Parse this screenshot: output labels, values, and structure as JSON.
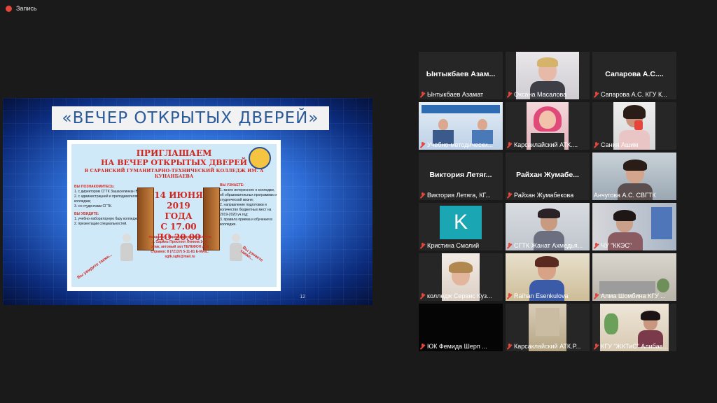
{
  "recording": {
    "label": "Запись"
  },
  "share": {
    "slide_title": "«ВЕЧЕР ОТКРЫТЫХ ДВЕРЕЙ»",
    "poster": {
      "h1": "ПРИГЛАШАЕМ",
      "h2": "НА ВЕЧЕР ОТКРЫТЫХ ДВЕРЕЙ",
      "h3": "В САРАНСКИЙ ГУМАНИТАРНО-ТЕХНИЧЕСКИЙ КОЛЛЕДЖ ИМ. А КУНАНБАЕВА",
      "left_head": "ВЫ ПОЗНАКОМИТЕСЬ:",
      "left_items": [
        "1. с директором СГТК Зашаселинкан В.А.;",
        "2. с администрацией и преподавателями колледжа;",
        "3. со студентами СГТК."
      ],
      "left_head2": "ВЫ УВИДИТЕ:",
      "left_items2": [
        "1. учебно-лабораторную базу колледжа;",
        "2. презентации специальностей."
      ],
      "right_head": "ВЫ УЗНАЕТЕ:",
      "right_items": [
        "1. много интересного о колледже, об образовательных программах и студенческой жизни;",
        "2. направление подготовки и количество бюджетных мест на 2019-2020 уч.год;",
        "3. правила приема и обучения в колледже."
      ],
      "date_l1": "14 ИЮНЯ",
      "date_l2": "2019 ГОДА",
      "date_l3": "С 17.00",
      "date_l4": "ДО 20.00",
      "address": "по адресу: Карагандинская область г. Сарань Проспект Ленина 14 1 этаж, актовый зал ТЕЛЕФОН для справок: 8 (72137) 5-11-81 E-MAIL: sgtk.sgtk@mail.ru",
      "side_left": "Вы увидите также...",
      "side_right": "Вы узнаете также..."
    },
    "slide_number": "12"
  },
  "participants": [
    {
      "display_name": "Ынтыкбаев Азам...",
      "label": "Ынтыкбаев Азамат",
      "video": false,
      "muted": true
    },
    {
      "display_name": "",
      "label": "Оксана Масалова",
      "video": true,
      "muted": true
    },
    {
      "display_name": "Сапарова А.С....",
      "label": "Сапарова А.С. КГУ К...",
      "video": false,
      "muted": true
    },
    {
      "display_name": "",
      "label": "Учебно-методически...",
      "video": true,
      "muted": true
    },
    {
      "display_name": "",
      "label": "Карсаклайский АТК....",
      "video": true,
      "muted": true
    },
    {
      "display_name": "",
      "label": "Сания Ашим",
      "video": true,
      "muted": true
    },
    {
      "display_name": "Виктория Летяг...",
      "label": "Виктория Летяга, КГ...",
      "video": false,
      "muted": true
    },
    {
      "display_name": "Райхан Жумабе...",
      "label": "Райхан Жумабекова",
      "video": false,
      "muted": true
    },
    {
      "display_name": "",
      "label": "Анчугова А.С. СВГТК",
      "video": true,
      "muted": false,
      "active": true
    },
    {
      "display_name": "",
      "label": "Кристина Смолий",
      "video": false,
      "muted": true,
      "avatar_letter": "K"
    },
    {
      "display_name": "",
      "label": "СГТК Жанат Ахмедья...",
      "video": true,
      "muted": true
    },
    {
      "display_name": "",
      "label": "ЧУ \"ККЭС\"",
      "video": true,
      "muted": true
    },
    {
      "display_name": "",
      "label": "колледж Сервис Куз...",
      "video": true,
      "muted": true
    },
    {
      "display_name": "",
      "label": "Raihan Esenkulova",
      "video": true,
      "muted": true
    },
    {
      "display_name": "",
      "label": "Алма Шомбина КГУ ...",
      "video": true,
      "muted": true
    },
    {
      "display_name": "",
      "label": "ЮК Фемида Шерп ...",
      "video": true,
      "muted": true
    },
    {
      "display_name": "",
      "label": "Карсаклайский АТК.Р...",
      "video": true,
      "muted": true
    },
    {
      "display_name": "",
      "label": "КГУ \"ЖКТиС\" Алибае...",
      "video": true,
      "muted": true
    }
  ]
}
